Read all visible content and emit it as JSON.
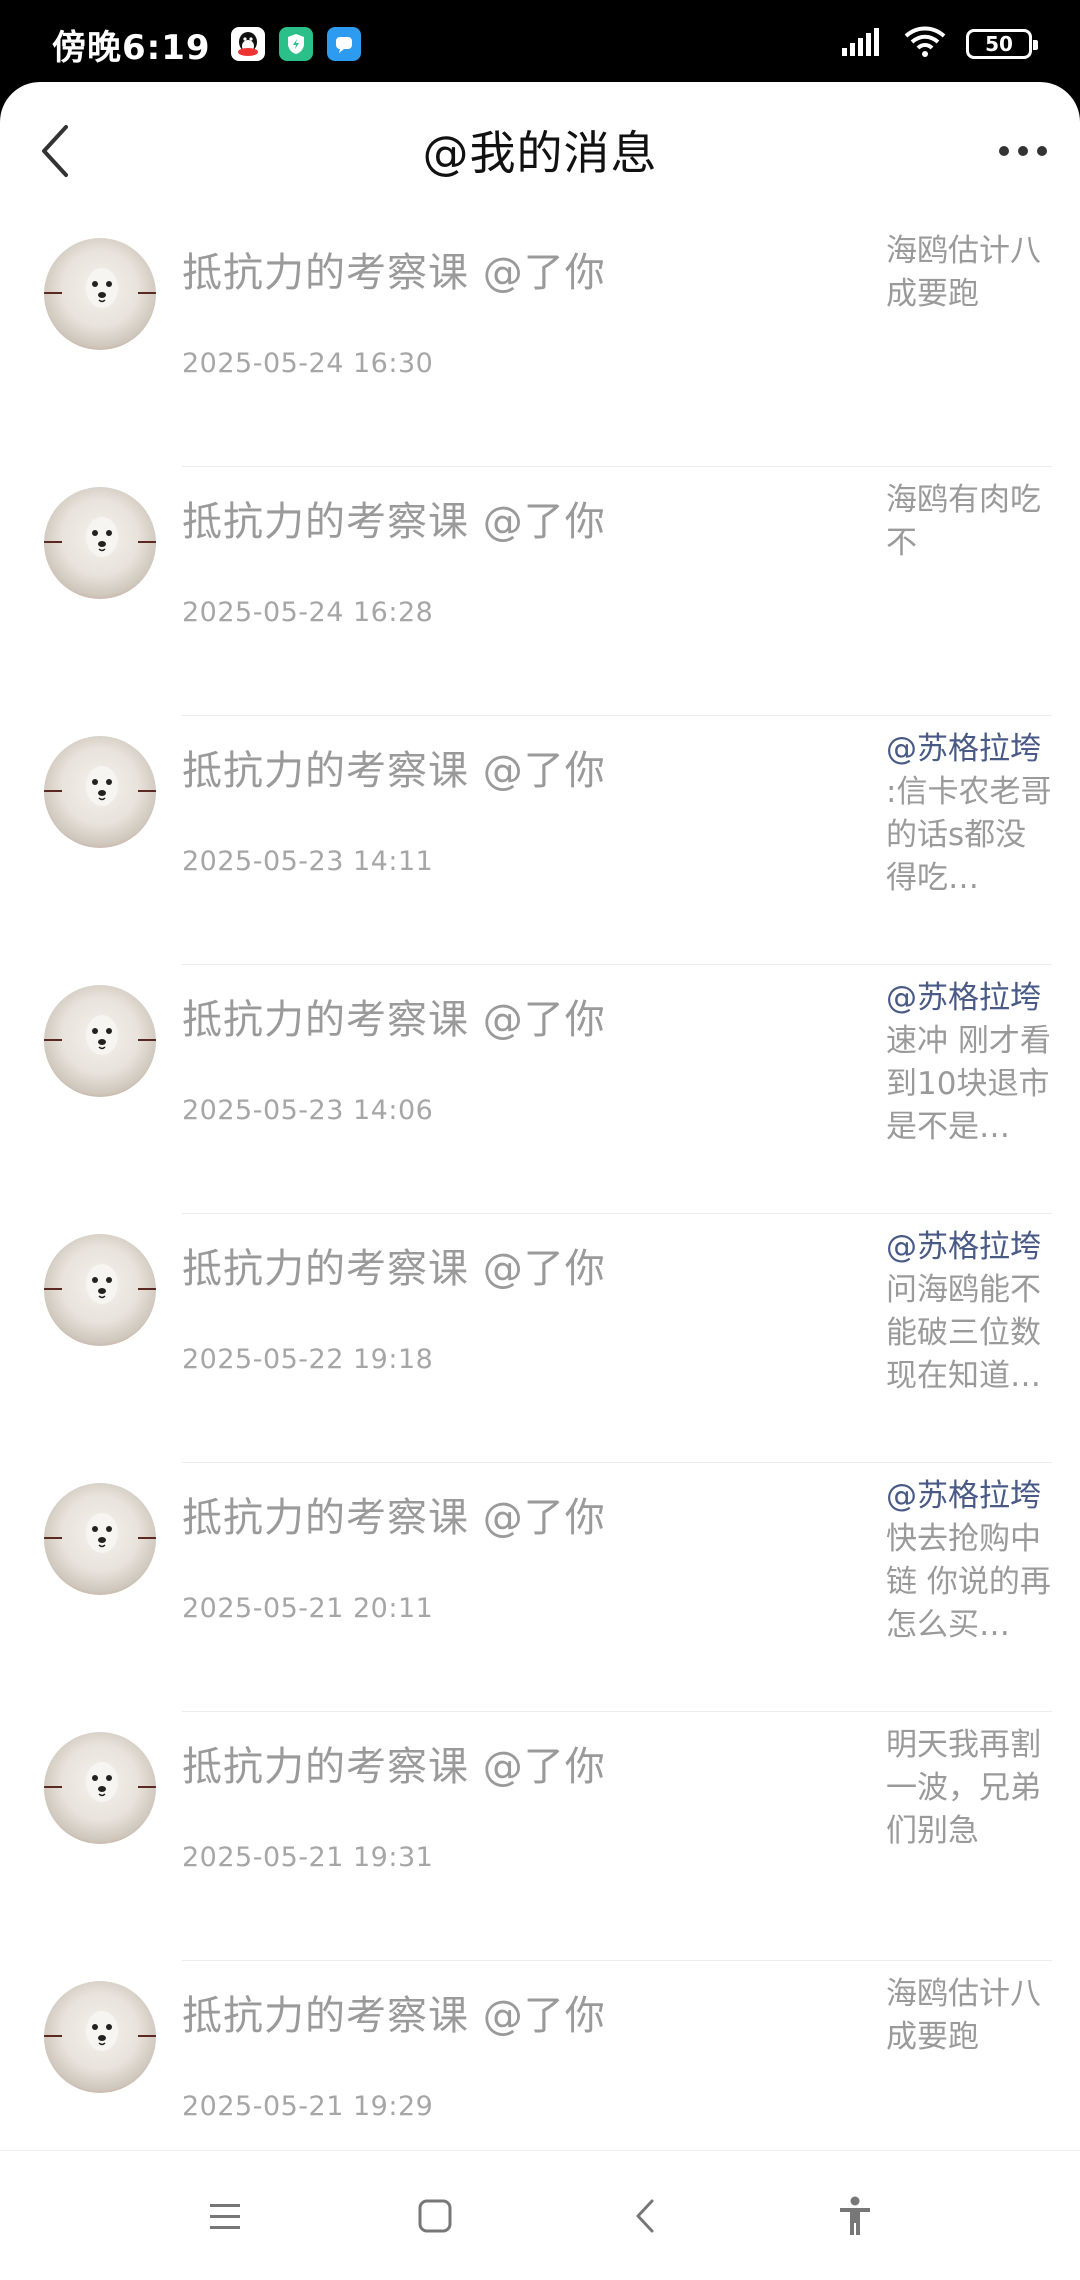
{
  "status_bar": {
    "time": "傍晚6:19",
    "battery": "50",
    "icons": [
      "qq-icon",
      "security-app-icon",
      "message-app-icon",
      "signal-icon",
      "wifi-icon",
      "battery-icon"
    ]
  },
  "header": {
    "title": "@我的消息",
    "back_icon": "chevron-left-icon",
    "more_icon": "more-horizontal-icon"
  },
  "messages": [
    {
      "title": "抵抗力的考察课 @了你",
      "time": "2025-05-24 16:30",
      "mention": "",
      "preview": "海鸥估计八成要跑"
    },
    {
      "title": "抵抗力的考察课 @了你",
      "time": "2025-05-24 16:28",
      "mention": "",
      "preview": "海鸥有肉吃不"
    },
    {
      "title": "抵抗力的考察课 @了你",
      "time": "2025-05-23 14:11",
      "mention": "@苏格拉垮",
      "preview": " :信卡农老哥的话s都没得吃…"
    },
    {
      "title": "抵抗力的考察课 @了你",
      "time": "2025-05-23 14:06",
      "mention": "@苏格拉垮",
      "preview": "速冲 刚才看到10块退市是不是…"
    },
    {
      "title": "抵抗力的考察课 @了你",
      "time": "2025-05-22 19:18",
      "mention": "@苏格拉垮",
      "preview": "问海鸥能不能破三位数现在知道…"
    },
    {
      "title": "抵抗力的考察课 @了你",
      "time": "2025-05-21 20:11",
      "mention": "@苏格拉垮",
      "preview": "快去抢购中链 你说的再怎么买…"
    },
    {
      "title": "抵抗力的考察课 @了你",
      "time": "2025-05-21 19:31",
      "mention": "",
      "preview": "明天我再割一波，兄弟们别急"
    },
    {
      "title": "抵抗力的考察课 @了你",
      "time": "2025-05-21 19:29",
      "mention": "",
      "preview": "海鸥估计八成要跑"
    }
  ],
  "nav_bar": {
    "icons": [
      "menu-icon",
      "home-square-icon",
      "back-chevron-icon",
      "accessibility-icon"
    ]
  },
  "colors": {
    "mention": "#4a5a86",
    "muted_text": "#9a9a9a",
    "background": "#ffffff"
  }
}
